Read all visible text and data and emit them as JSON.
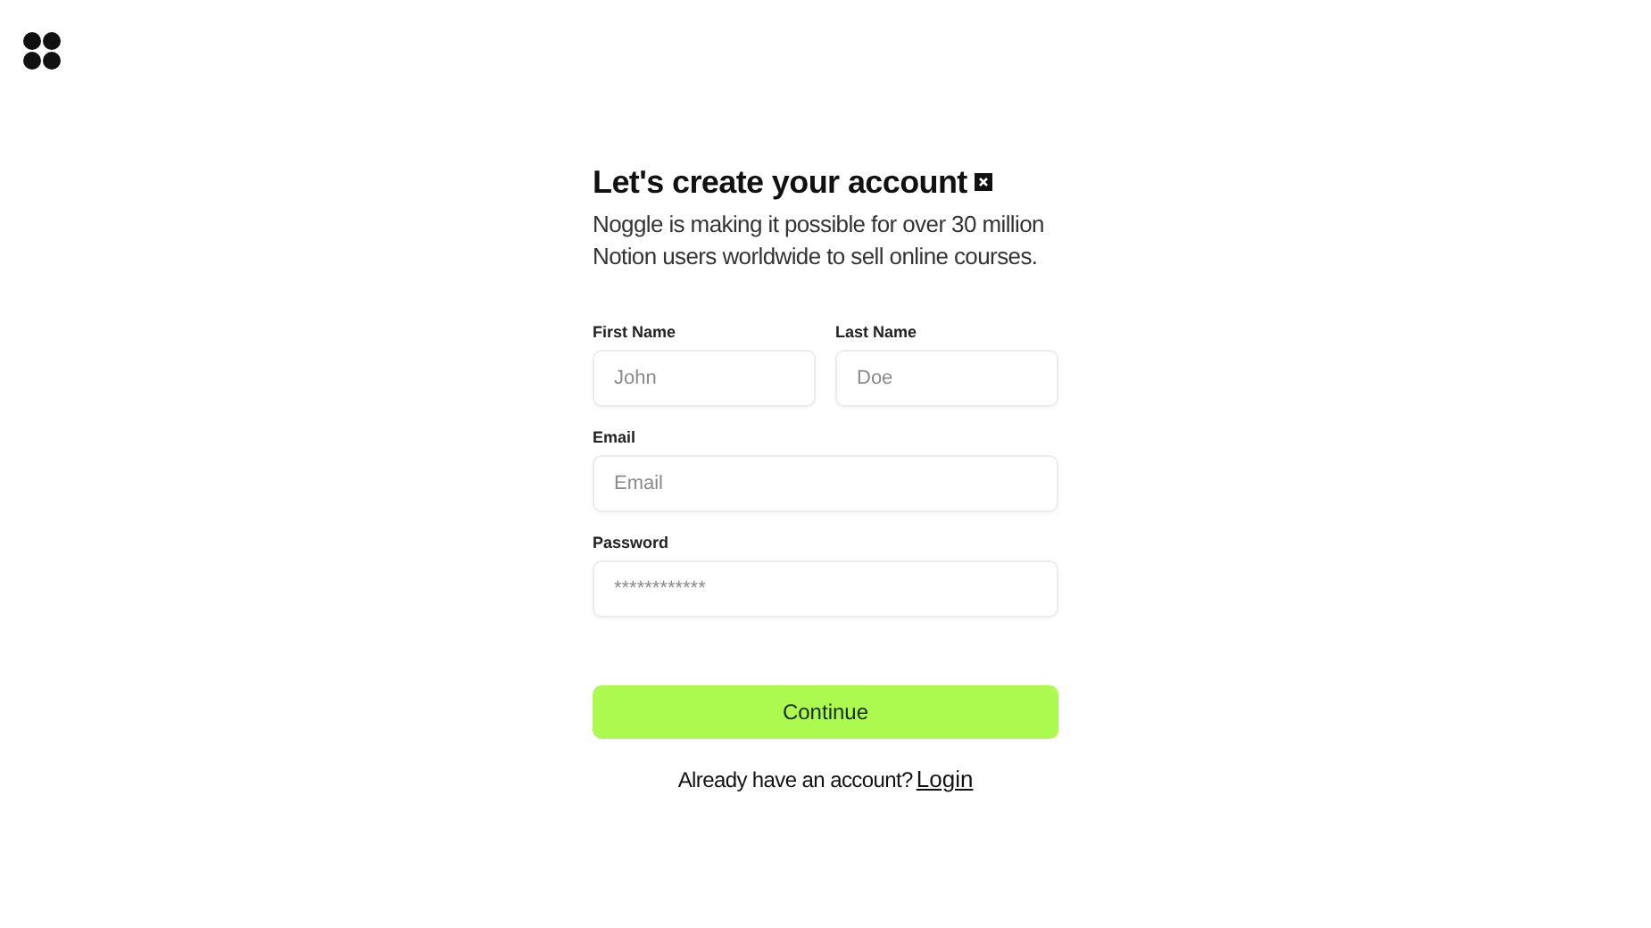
{
  "title": "Let's create your account",
  "subtitle": "Noggle is making it possible for over 30 million Notion users worldwide to sell online courses.",
  "name_fields": [
    {
      "label": "First Name",
      "placeholder": "John"
    },
    {
      "label": "Last Name",
      "placeholder": "Doe"
    }
  ],
  "fields": [
    {
      "label": "Email",
      "placeholder": "Email"
    },
    {
      "label": "Password",
      "placeholder": "************"
    }
  ],
  "submit": "Continue",
  "footer": {
    "text": "Already have an account?",
    "link": "Login"
  }
}
